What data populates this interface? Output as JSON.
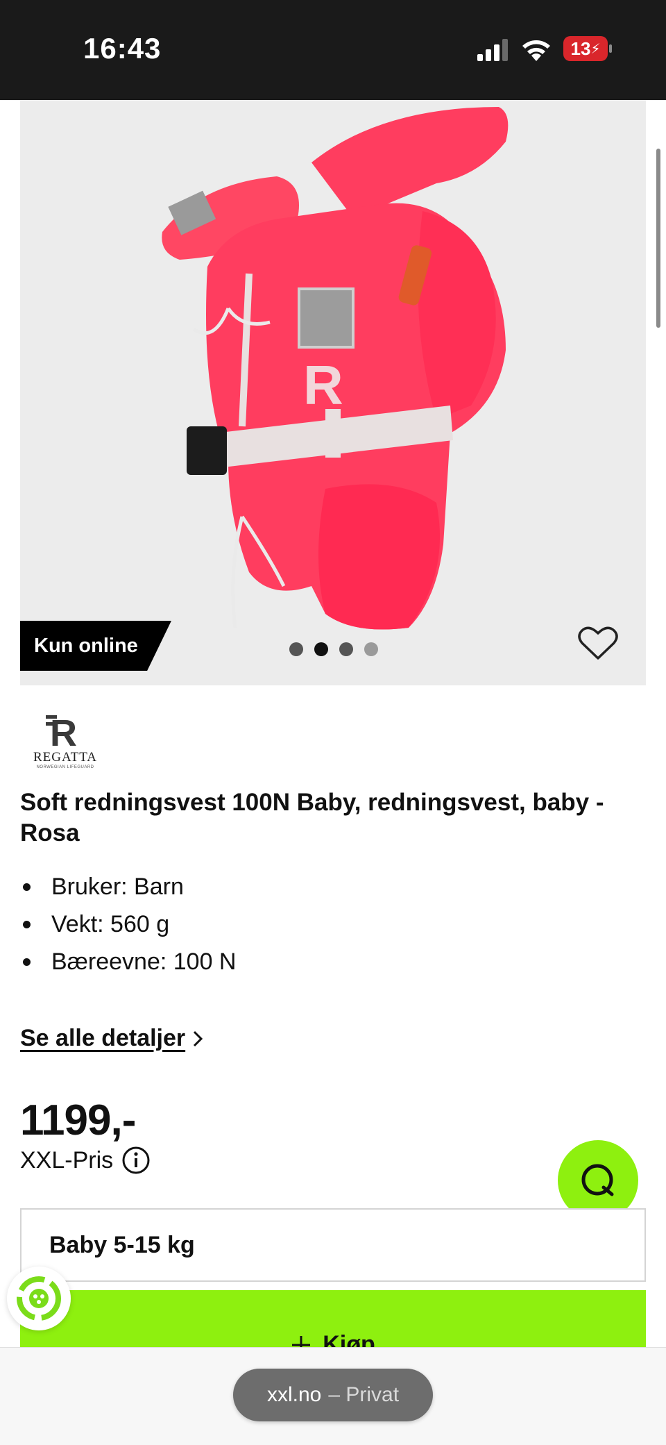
{
  "status_bar": {
    "time": "16:43",
    "battery_level": "13"
  },
  "gallery": {
    "badge": "Kun online",
    "image_count": 4,
    "active_index": 1
  },
  "brand": {
    "name": "REGATTA",
    "tagline": "NORWEGIAN LIFEGUARD"
  },
  "product": {
    "title": "Soft redningsvest 100N Baby, redningsvest, baby - Rosa",
    "specs": [
      "Bruker: Barn",
      "Vekt: 560 g",
      "Bæreevne: 100 N"
    ],
    "details_link": "Se alle detaljer",
    "price": "1199,-",
    "price_label": "XXL-Pris",
    "selected_size": "Baby 5-15 kg",
    "buy_label": "Kjøp"
  },
  "browser": {
    "domain": "xxl.no",
    "mode": "– Privat"
  },
  "colors": {
    "accent": "#8ef00f",
    "vest": "#ff3d5f",
    "badge_bg": "#000000"
  }
}
